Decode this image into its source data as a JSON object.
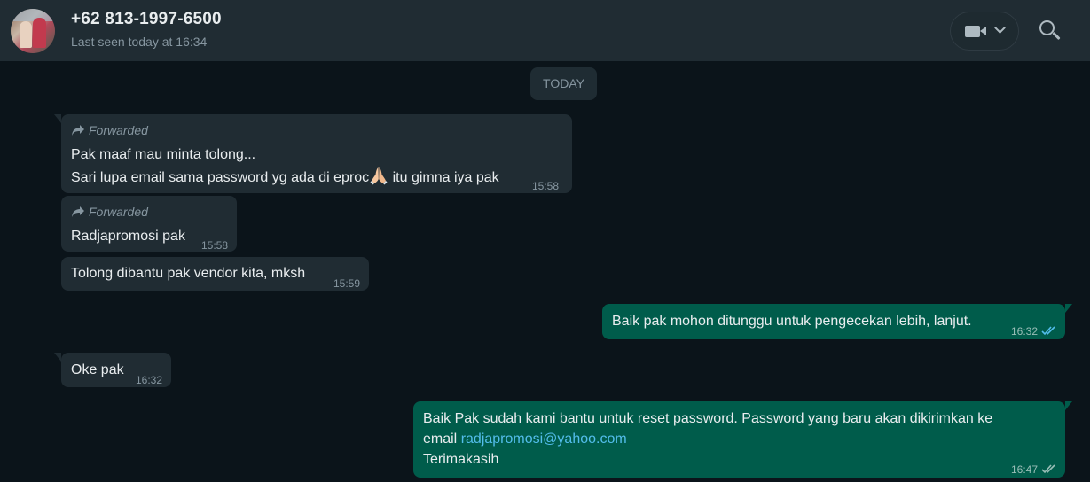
{
  "header": {
    "contact_name": "+62 813-1997-6500",
    "status": "Last seen today at 16:34",
    "icons": [
      "avatar",
      "video-call-icon",
      "chevron-down-icon",
      "search-icon"
    ]
  },
  "date_divider": "TODAY",
  "messages": [
    {
      "direction": "incoming",
      "forwarded_label": "Forwarded",
      "line1": "Pak maaf mau minta tolong...",
      "line2_a": "Sari lupa email sama password yg ada di eproc",
      "emoji": "folded-hands",
      "line2_b": " itu gimna iya pak",
      "time": "15:58"
    },
    {
      "direction": "incoming",
      "forwarded_label": "Forwarded",
      "text": "Radjapromosi pak",
      "time": "15:58"
    },
    {
      "direction": "incoming",
      "text": "Tolong dibantu pak vendor kita, mksh",
      "time": "15:59"
    },
    {
      "direction": "outgoing",
      "text": "Baik pak mohon ditunggu untuk pengecekan lebih, lanjut.",
      "time": "16:32",
      "status": "read"
    },
    {
      "direction": "incoming",
      "text": "Oke pak",
      "time": "16:32"
    },
    {
      "direction": "outgoing",
      "line1": "Baik Pak sudah kami bantu untuk reset password. Password yang baru akan dikirimkan ke",
      "line2_prefix": "email ",
      "link": "radjapromosi@yahoo.com",
      "line3": "Terimakasih",
      "time": "16:47",
      "status": "delivered"
    }
  ],
  "colors": {
    "background": "#0b141a",
    "header": "#202c33",
    "incoming_bubble": "#202c33",
    "outgoing_bubble": "#005c4b",
    "link": "#53bdeb",
    "read_ticks": "#53bdeb",
    "delivered_ticks": "#99beb7"
  }
}
